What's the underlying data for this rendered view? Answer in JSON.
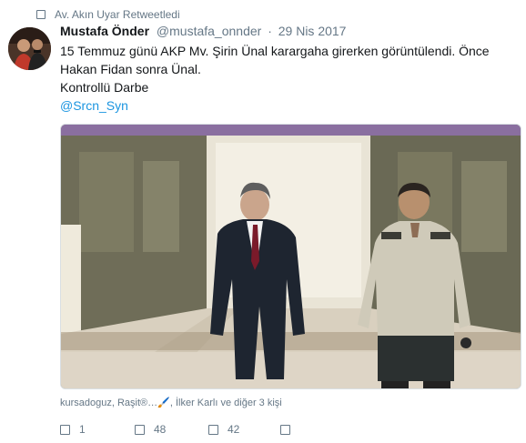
{
  "retweet_context": {
    "icon": "retweet-icon",
    "text": "Av. Akın Uyar Retweetledi"
  },
  "tweet": {
    "author_name": "Mustafa Önder",
    "author_handle": "@mustafa_onnder",
    "separator": "·",
    "date": "29 Nis 2017",
    "text_lines": [
      "15 Temmuz günü AKP Mv. Şirin Ünal karargaha girerken görüntülendi. Önce",
      "Hakan Fidan sonra Ünal.",
      "Kontrollü Darbe"
    ],
    "mention": "@Srcn_Syn"
  },
  "likers": "kursadoguz, Raşit®…🖌️, İlker Karlı ve diğer 3 kişi",
  "actions": {
    "reply": {
      "icon": "reply-icon",
      "count": "1"
    },
    "retweet": {
      "icon": "retweet-icon",
      "count": "48"
    },
    "like": {
      "icon": "like-icon",
      "count": "42"
    },
    "dm": {
      "icon": "dm-icon"
    }
  },
  "colors": {
    "text": "#14171a",
    "muted": "#657786",
    "link": "#1b95e0"
  }
}
